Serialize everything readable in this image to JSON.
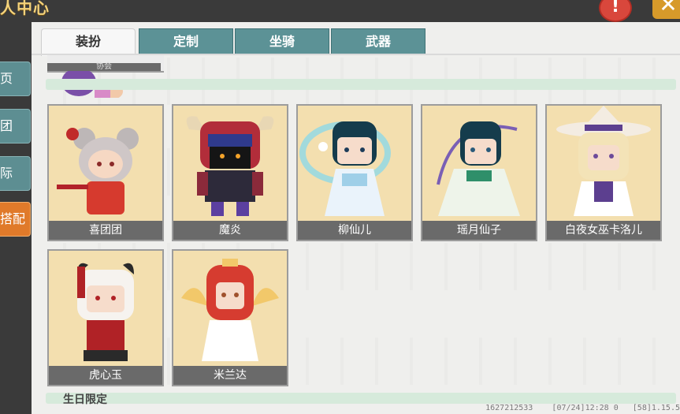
{
  "title": "人中心",
  "warning_glyph": "!",
  "close_glyph": "✕",
  "sidebar": {
    "items": [
      {
        "label": "页"
      },
      {
        "label": "团"
      },
      {
        "label": "际"
      },
      {
        "label": "搭配"
      }
    ],
    "active_index": 3
  },
  "tabs": [
    {
      "label": "装扮",
      "active": true
    },
    {
      "label": "定制"
    },
    {
      "label": "坐骑"
    },
    {
      "label": "武器"
    }
  ],
  "partial_card_label": "协会",
  "cards": [
    {
      "name": "喜团团",
      "palette": [
        "#a33",
        "#cfc7c7",
        "#e46b4a"
      ]
    },
    {
      "name": "魔炎",
      "palette": [
        "#b22d3a",
        "#2d2a3a",
        "#8b2a3a"
      ]
    },
    {
      "name": "柳仙儿",
      "palette": [
        "#7fd7f0",
        "#153c4c",
        "#ffffff"
      ]
    },
    {
      "name": "瑶月仙子",
      "palette": [
        "#7a5fb5",
        "#153c4c",
        "#eef4ea"
      ]
    },
    {
      "name": "白夜女巫卡洛儿",
      "palette": [
        "#5c3f8f",
        "#f3e3b7",
        "#ffffff"
      ]
    },
    {
      "name": "虎心玉",
      "palette": [
        "#b02226",
        "#f6f3ef",
        "#2a2a2a"
      ]
    },
    {
      "name": "米兰达",
      "palette": [
        "#d63c30",
        "#f2c86a",
        "#ffffff"
      ]
    }
  ],
  "section_partial_label": "生日限定",
  "footer": {
    "id": "1627212533",
    "date": "[07/24]12:28 0",
    "version": "[58]1.15.5"
  }
}
